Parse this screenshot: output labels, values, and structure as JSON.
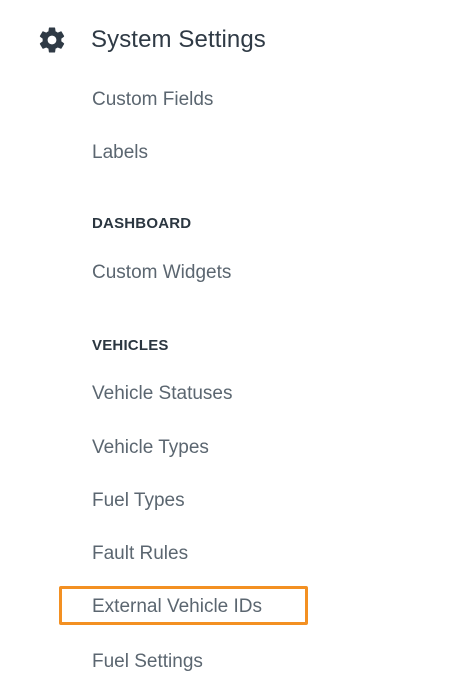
{
  "header": {
    "title": "System Settings",
    "icon": "gear-icon"
  },
  "items": {
    "custom_fields": "Custom Fields",
    "labels": "Labels",
    "custom_widgets": "Custom Widgets",
    "vehicle_statuses": "Vehicle Statuses",
    "vehicle_types": "Vehicle Types",
    "fuel_types": "Fuel Types",
    "fault_rules": "Fault Rules",
    "external_vehicle_ids": "External Vehicle IDs",
    "fuel_settings": "Fuel Settings"
  },
  "sections": {
    "dashboard": "DASHBOARD",
    "vehicles": "VEHICLES"
  },
  "colors": {
    "highlight": "#f39022",
    "text_primary": "#2f3a45",
    "text_item": "#5b6670"
  }
}
